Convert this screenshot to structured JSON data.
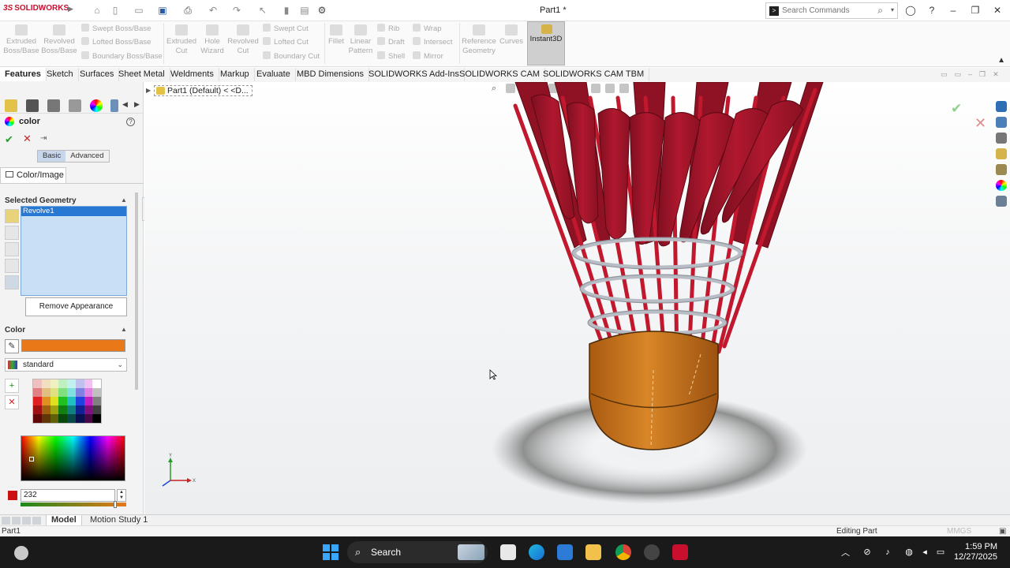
{
  "title_bar": {
    "logo_ds": "3S",
    "logo_text": "SOLIDWORKS",
    "document_title": "Part1 *",
    "search_placeholder": "Search Commands"
  },
  "ribbon": {
    "features": {
      "extruded_boss": "Extruded Boss/Base",
      "revolved_boss": "Revolved Boss/Base",
      "swept_boss": "Swept Boss/Base",
      "lofted_boss": "Lofted Boss/Base",
      "boundary_boss": "Boundary Boss/Base",
      "extruded_cut": "Extruded Cut",
      "hole_wizard": "Hole Wizard",
      "revolved_cut": "Revolved Cut",
      "swept_cut": "Swept Cut",
      "lofted_cut": "Lofted Cut",
      "boundary_cut": "Boundary Cut",
      "fillet": "Fillet",
      "linear_pattern": "Linear Pattern",
      "rib": "Rib",
      "draft": "Draft",
      "shell": "Shell",
      "wrap": "Wrap",
      "intersect": "Intersect",
      "mirror": "Mirror",
      "reference_geometry": "Reference Geometry",
      "curves": "Curves",
      "instant3d": "Instant3D"
    }
  },
  "tabs": [
    {
      "label": "Features",
      "active": true
    },
    {
      "label": "Sketch"
    },
    {
      "label": "Surfaces"
    },
    {
      "label": "Sheet Metal"
    },
    {
      "label": "Weldments"
    },
    {
      "label": "Markup"
    },
    {
      "label": "Evaluate"
    },
    {
      "label": "MBD Dimensions"
    },
    {
      "label": "SOLIDWORKS Add-Ins"
    },
    {
      "label": "SOLIDWORKS CAM"
    },
    {
      "label": "SOLIDWORKS CAM TBM"
    }
  ],
  "property_manager": {
    "title": "color",
    "mode_basic": "Basic",
    "mode_advanced": "Advanced",
    "tab_color_image": "Color/Image",
    "selected_geometry_header": "Selected Geometry",
    "selected_item": "Revolve1",
    "remove_appearance": "Remove Appearance",
    "color_header": "Color",
    "current_color": "#e87818",
    "palette": "standard",
    "value": "232"
  },
  "viewport": {
    "breadcrumb": "Part1 (Default) < <D...",
    "axis_x": "X",
    "axis_y": "Y"
  },
  "bottom_tabs": [
    {
      "label": "Model",
      "active": true
    },
    {
      "label": "Motion Study 1"
    }
  ],
  "status": {
    "left": "Part1",
    "mode": "Editing Part",
    "units": "MMGS"
  },
  "taskbar": {
    "search": "Search",
    "time": "1:59 PM",
    "date": "12/27/2025"
  },
  "colors": {
    "feathers": "#a8162e",
    "base": "#c9721a",
    "rings": "#b8bcc4"
  }
}
